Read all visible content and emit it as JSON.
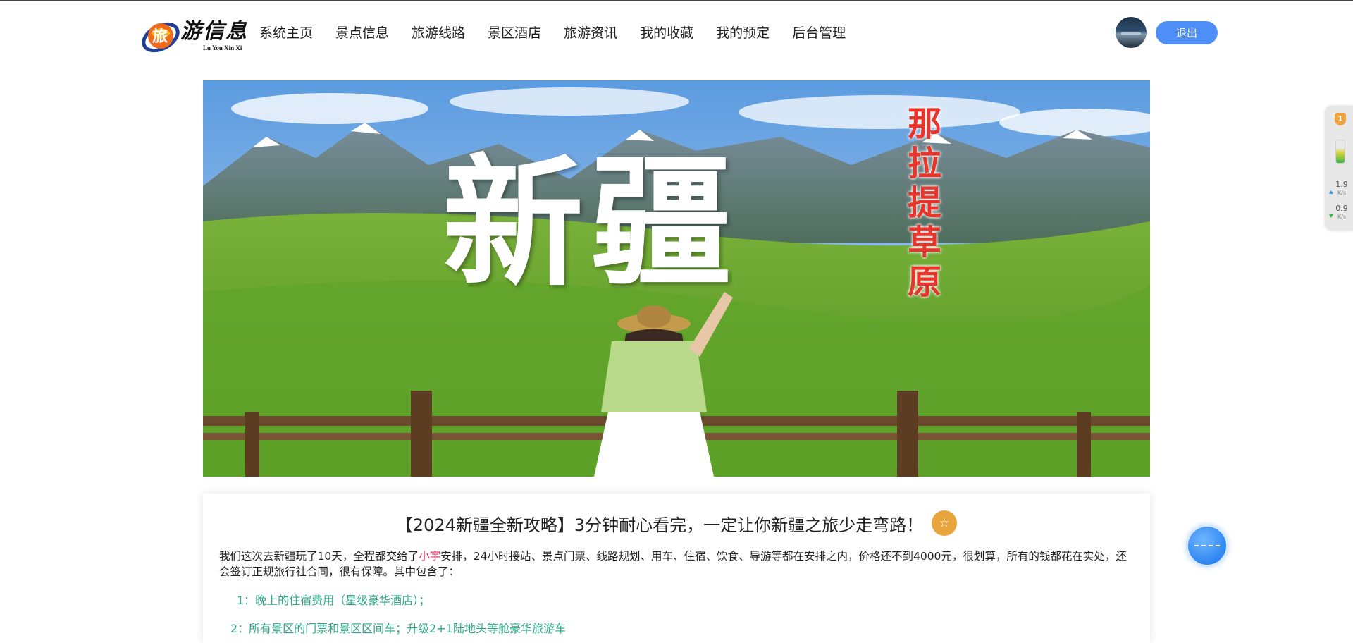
{
  "header": {
    "logo": {
      "text": "游信息",
      "subtitle": "Lu You Xin Xi"
    },
    "nav": [
      {
        "label": "系统主页"
      },
      {
        "label": "景点信息"
      },
      {
        "label": "旅游线路"
      },
      {
        "label": "景区酒店"
      },
      {
        "label": "旅游资讯"
      },
      {
        "label": "我的收藏"
      },
      {
        "label": "我的预定"
      },
      {
        "label": "后台管理"
      }
    ],
    "logout_label": "退出"
  },
  "banner": {
    "title_big": "新疆",
    "title_side": "那拉提草原",
    "active_slide": 1
  },
  "article": {
    "title": "【2024新疆全新攻略】3分钟耐心看完，一定让你新疆之旅少走弯路！",
    "favorite_icon": "☆",
    "body_before": "我们这次去新疆玩了10天，全程都交给了",
    "body_highlight": "小宇",
    "body_after": "安排，24小时接站、景点门票、线路规划、用车、住宿、饮食、导游等都在安排之内，价格还不到4000元，很划算，所有的钱都花在实处，还会签订正规旅行社合同，很有保障。其中包含了：",
    "list": [
      "1：晚上的住宿费用（星级豪华酒店）；",
      "2：所有景区的门票和景区区间车；升级2+1陆地头等舱豪华旅游车"
    ]
  },
  "side_widget": {
    "badge": "1",
    "upload_speed": "1.9",
    "download_speed": "0.9",
    "unit": "K/s"
  },
  "colors": {
    "accent_blue": "#4d8ef7",
    "favorite_orange": "#e7a53c",
    "highlight_red": "#e02e5a",
    "list_green": "#2ea88a"
  }
}
